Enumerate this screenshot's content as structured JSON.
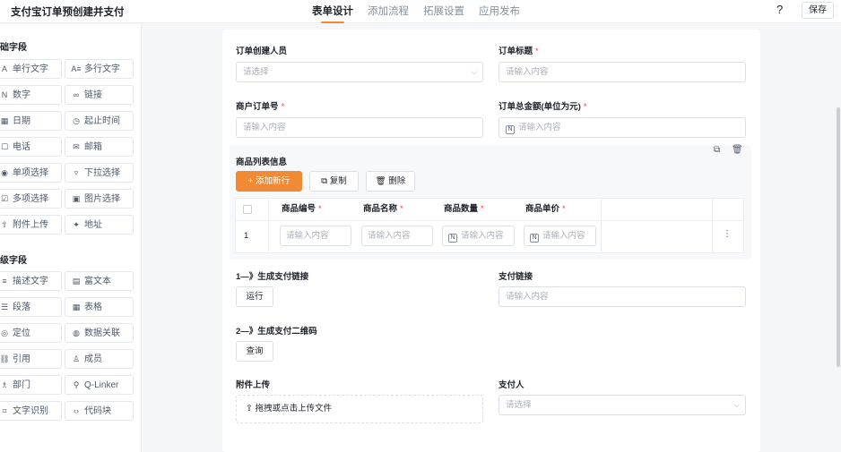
{
  "header": {
    "app_title": "支付宝订单预创建并支付",
    "tabs": [
      {
        "label": "表单设计",
        "active": true
      },
      {
        "label": "添加流程",
        "active": false
      },
      {
        "label": "拓展设置",
        "active": false
      },
      {
        "label": "应用发布",
        "active": false
      }
    ],
    "help": "?",
    "save_label": "保存"
  },
  "colors": {
    "accent": "#f08a34",
    "required": "#f53f3f"
  },
  "sidebar": {
    "basic_group": "础字段",
    "basic": [
      {
        "label": "单行文字",
        "icon": "A"
      },
      {
        "label": "多行文字",
        "icon": "A≡"
      },
      {
        "label": "数字",
        "icon": "N"
      },
      {
        "label": "链接",
        "icon": "∞"
      },
      {
        "label": "日期",
        "icon": "▦"
      },
      {
        "label": "起止时间",
        "icon": "◷"
      },
      {
        "label": "电话",
        "icon": "☐"
      },
      {
        "label": "邮箱",
        "icon": "✉"
      },
      {
        "label": "单项选择",
        "icon": "◉"
      },
      {
        "label": "下拉选择",
        "icon": "▿"
      },
      {
        "label": "多项选择",
        "icon": "☑"
      },
      {
        "label": "图片选择",
        "icon": "▣"
      },
      {
        "label": "附件上传",
        "icon": "⇧"
      },
      {
        "label": "地址",
        "icon": "✦"
      }
    ],
    "advanced_group": "级字段",
    "advanced": [
      {
        "label": "描述文字",
        "icon": "≡"
      },
      {
        "label": "富文本",
        "icon": "▤"
      },
      {
        "label": "段落",
        "icon": "☰"
      },
      {
        "label": "表格",
        "icon": "▦"
      },
      {
        "label": "定位",
        "icon": "◎"
      },
      {
        "label": "数据关联",
        "icon": "◍"
      },
      {
        "label": "引用",
        "icon": "⛓"
      },
      {
        "label": "成员",
        "icon": "♙"
      },
      {
        "label": "部门",
        "icon": "♗"
      },
      {
        "label": "Q-Linker",
        "icon": "⚲"
      },
      {
        "label": "文字识别",
        "icon": "⌗"
      },
      {
        "label": "代码块",
        "icon": "‹›"
      }
    ]
  },
  "form": {
    "creator": {
      "label": "订单创建人员",
      "placeholder": "请选择"
    },
    "title": {
      "label": "订单标题",
      "required": "*",
      "placeholder": "请输入内容"
    },
    "merchant_no": {
      "label": "商户订单号",
      "required": "*",
      "placeholder": "请输入内容"
    },
    "amount": {
      "label": "订单总金额(单位为元)",
      "required": "*",
      "placeholder": "请输入内容",
      "icon": "N"
    },
    "product_list": {
      "label": "商品列表信息",
      "add_label": "+ 添加新行",
      "copy_label": "复制",
      "delete_label": "删除",
      "columns": [
        {
          "label": "商品编号",
          "required": "*"
        },
        {
          "label": "商品名称",
          "required": "*"
        },
        {
          "label": "商品数量",
          "required": "*"
        },
        {
          "label": "商品单价",
          "required": "*"
        }
      ],
      "row_number": "1",
      "cells": [
        {
          "placeholder": "请输入内容",
          "icon": ""
        },
        {
          "placeholder": "请输入内容",
          "icon": ""
        },
        {
          "placeholder": "请输入内容",
          "icon": "N"
        },
        {
          "placeholder": "请输入内容",
          "icon": "N"
        }
      ],
      "more": "⋮"
    },
    "gen_link": {
      "label": "1—》生成支付链接",
      "button": "运行"
    },
    "pay_link": {
      "label": "支付链接",
      "placeholder": "请输入内容"
    },
    "gen_qr": {
      "label": "2—》生成支付二维码",
      "button": "查询"
    },
    "attachment": {
      "label": "附件上传",
      "upload_text": "拖拽或点击上传文件",
      "icon": "⇧"
    },
    "payer": {
      "label": "支付人",
      "placeholder": "请选择"
    }
  }
}
